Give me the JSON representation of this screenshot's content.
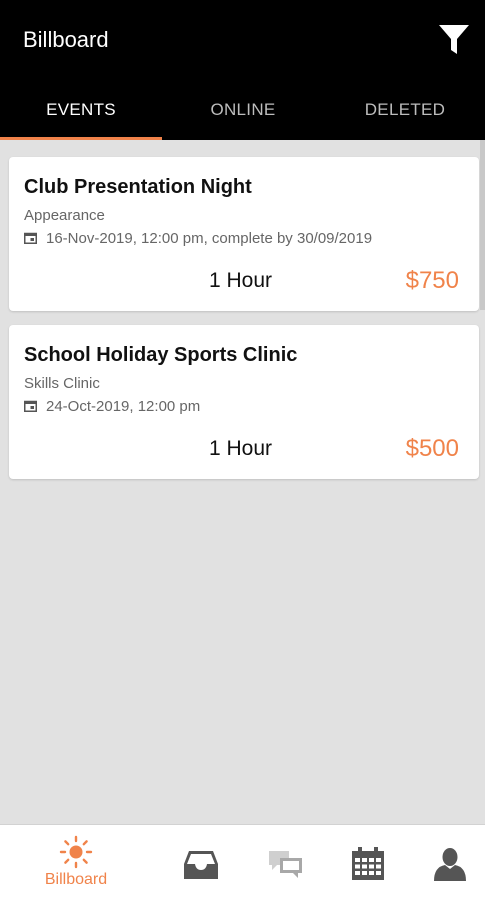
{
  "app": {
    "title": "Billboard"
  },
  "tabs": [
    {
      "label": "EVENTS",
      "active": true
    },
    {
      "label": "ONLINE",
      "active": false
    },
    {
      "label": "DELETED",
      "active": false
    }
  ],
  "events": [
    {
      "title": "Club Presentation Night",
      "category": "Appearance",
      "datetime": "16-Nov-2019,  12:00 pm, complete by 30/09/2019",
      "duration": "1 Hour",
      "price": "$750"
    },
    {
      "title": "School Holiday Sports Clinic",
      "category": "Skills Clinic",
      "datetime": "24-Oct-2019,  12:00 pm",
      "duration": "1 Hour",
      "price": "$500"
    }
  ],
  "bottom_nav": [
    {
      "icon": "sun-icon",
      "label": "Billboard",
      "active": true
    },
    {
      "icon": "inbox-icon",
      "label": ""
    },
    {
      "icon": "chat-icon",
      "label": ""
    },
    {
      "icon": "calendar-icon",
      "label": ""
    },
    {
      "icon": "person-icon",
      "label": ""
    }
  ],
  "colors": {
    "accent": "#f0834a",
    "header": "#000000",
    "background": "#e1e1e1"
  }
}
